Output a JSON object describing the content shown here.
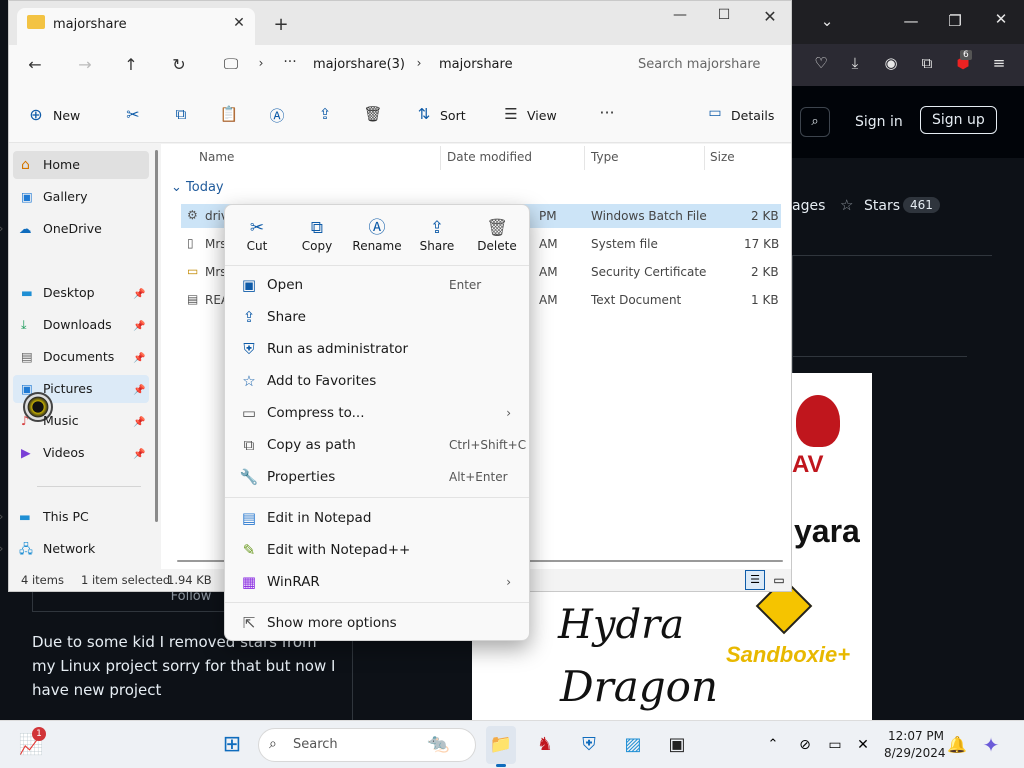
{
  "explorer": {
    "tab_title": "majorshare",
    "breadcrumb": [
      "majorshare(3)",
      "majorshare"
    ],
    "search_placeholder": "Search majorshare",
    "toolbar": {
      "new": "New",
      "sort": "Sort",
      "view": "View",
      "details": "Details"
    },
    "nav": {
      "home": "Home",
      "gallery": "Gallery",
      "onedrive": "OneDrive",
      "desktop": "Desktop",
      "downloads": "Downloads",
      "documents": "Documents",
      "pictures": "Pictures",
      "music": "Music",
      "videos": "Videos",
      "thispc": "This PC",
      "network": "Network"
    },
    "columns": {
      "name": "Name",
      "date": "Date modified",
      "type": "Type",
      "size": "Size"
    },
    "group": "Today",
    "rows": [
      {
        "name": "driv",
        "time": "PM",
        "type": "Windows Batch File",
        "size": "2 KB"
      },
      {
        "name": "Mrs",
        "time": "AM",
        "type": "System file",
        "size": "17 KB"
      },
      {
        "name": "Mrs",
        "time": "AM",
        "type": "Security Certificate",
        "size": "2 KB"
      },
      {
        "name": "REA",
        "time": "AM",
        "type": "Text Document",
        "size": "1 KB"
      }
    ],
    "status": {
      "items": "4 items",
      "selected": "1 item selected",
      "size": "1.94 KB"
    }
  },
  "context_menu": {
    "quick": {
      "cut": "Cut",
      "copy": "Copy",
      "rename": "Rename",
      "share": "Share",
      "delete": "Delete"
    },
    "items": {
      "open": "Open",
      "open_sc": "Enter",
      "share": "Share",
      "runadmin": "Run as administrator",
      "favorites": "Add to Favorites",
      "compress": "Compress to...",
      "copypath": "Copy as path",
      "copypath_sc": "Ctrl+Shift+C",
      "properties": "Properties",
      "properties_sc": "Alt+Enter",
      "notepad": "Edit in Notepad",
      "notepadpp": "Edit with Notepad++",
      "winrar": "WinRAR",
      "more": "Show more options"
    }
  },
  "browser": {
    "signin": "Sign in",
    "signup": "Sign up",
    "ages_fragment": "ages",
    "stars_label": "Stars",
    "stars_count": "461",
    "ext_badge": "6",
    "follow": "Follow",
    "bio": "Due to some kid I removed stars from my Linux project sorry for that but now I have new project",
    "banner": {
      "av": "AV",
      "yara": "yara",
      "hydra": "Hydra",
      "dragon": "Dragon",
      "sandboxie": "Sandboxie+"
    }
  },
  "taskbar": {
    "search_label": "Search",
    "time": "12:07 PM",
    "date": "8/29/2024",
    "widget_badge": "1"
  },
  "colors": {
    "accent": "#0e5ba8",
    "selection": "#cce4f7"
  }
}
